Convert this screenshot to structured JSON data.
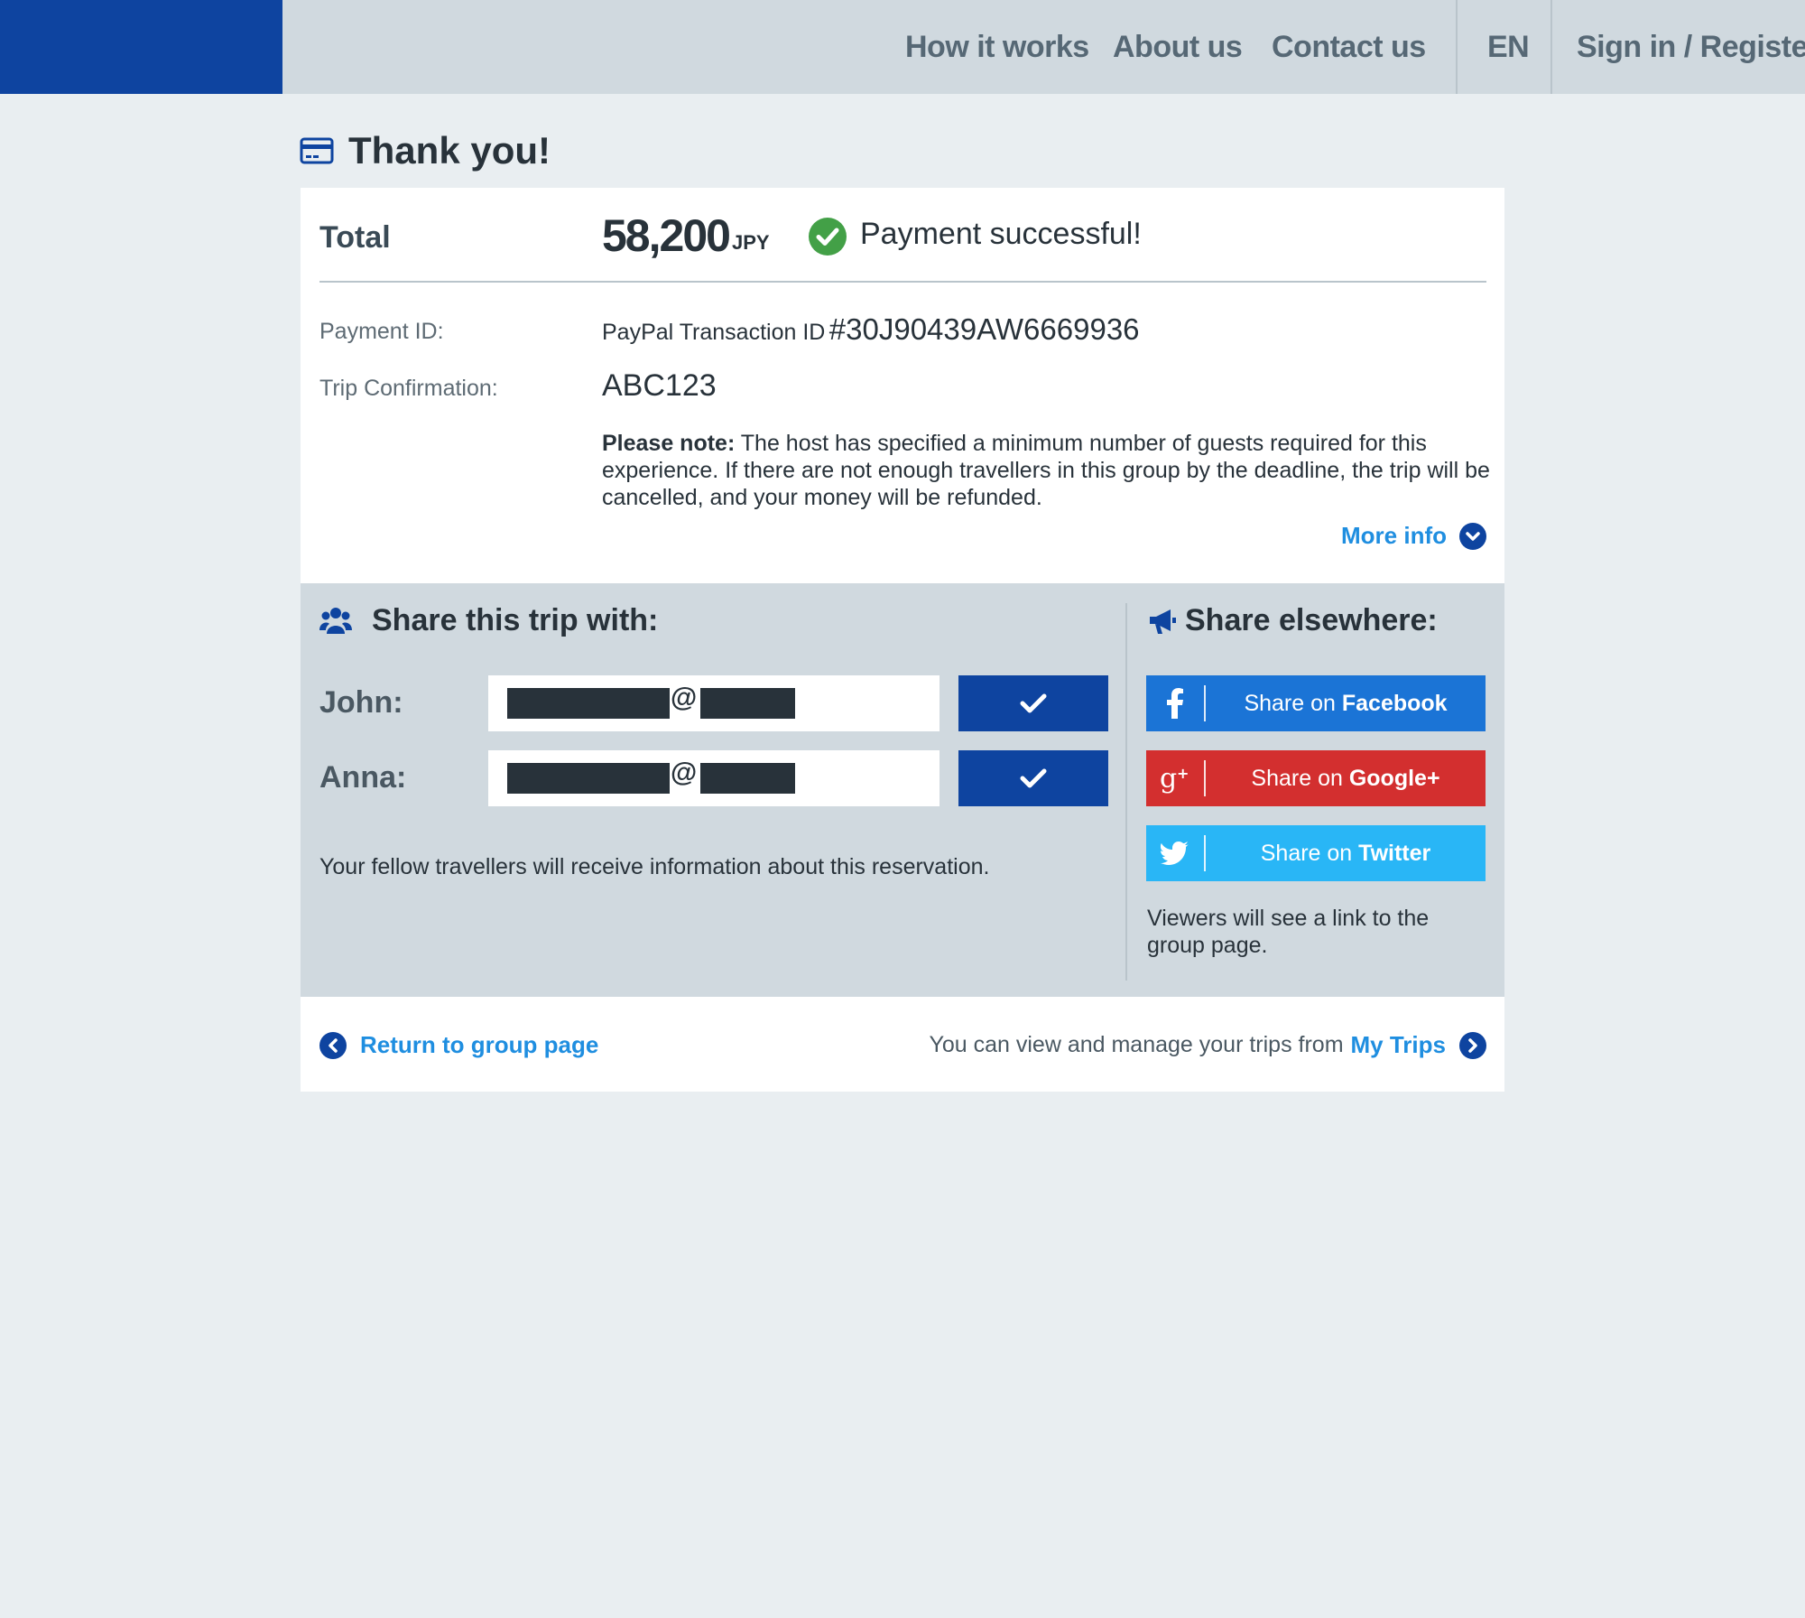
{
  "header": {
    "nav": [
      "How it works",
      "About us",
      "Contact us"
    ],
    "language": "EN",
    "signin": "Sign in / Register"
  },
  "page": {
    "title": "Thank you!"
  },
  "payment": {
    "total_label": "Total",
    "amount": "58,200",
    "currency": "JPY",
    "status": "Payment successful!",
    "payment_id_label": "Payment ID:",
    "paypal_prefix": "PayPal Transaction ID",
    "paypal_id": "#30J90439AW6669936",
    "trip_conf_label": "Trip Confirmation:",
    "trip_conf_value": "ABC123",
    "note_bold": "Please note:",
    "note_text": " The host has specified a minimum number of guests required for this experience. If there are not enough travellers in this group by the deadline, the trip will be cancelled, and your money will be refunded.",
    "more_info": "More info"
  },
  "share": {
    "title": "Share this trip with:",
    "people": [
      {
        "name": "John:",
        "email_at": "@"
      },
      {
        "name": "Anna:",
        "email_at": "@"
      }
    ],
    "info": "Your fellow travellers will receive information about this reservation."
  },
  "share_elsewhere": {
    "title": "Share elsewhere:",
    "buttons": [
      {
        "prefix": "Share on ",
        "network": "Facebook",
        "icon": "facebook-icon",
        "color": "#1b74d6"
      },
      {
        "prefix": "Share on ",
        "network": "Google+",
        "icon": "google-plus-icon",
        "color": "#d32f2f"
      },
      {
        "prefix": "Share on ",
        "network": "Twitter",
        "icon": "twitter-icon",
        "color": "#29b6f6"
      }
    ],
    "viewers": "Viewers will see a link to the group page."
  },
  "footer": {
    "return": "Return to group page",
    "trips_text": "You can view and manage your trips from",
    "trips_link": "My Trips"
  },
  "colors": {
    "brand": "#0e44a0",
    "link": "#1f8ee0",
    "success": "#43a047"
  }
}
